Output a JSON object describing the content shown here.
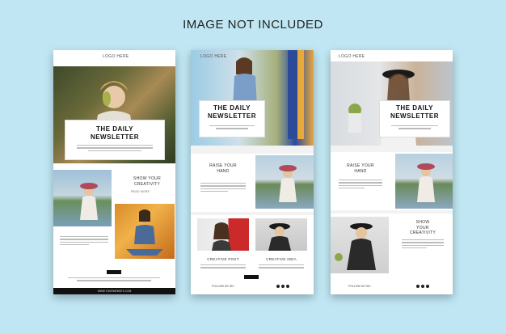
{
  "banner": "IMAGE NOT INCLUDED",
  "card1": {
    "logo": "LOGO HERE",
    "title_line1": "THE DAILY",
    "title_line2": "NEWSLETTER",
    "side_heading_1": "SHOW YOUR",
    "side_heading_2": "CREATIVITY",
    "read_more": "READ MORE",
    "footer": "WWW.YOURWEBSITE.COM"
  },
  "card2": {
    "logo": "LOGO HERE",
    "title_line1": "THE DAILY",
    "title_line2": "NEWSLETTER",
    "raise_1": "RAISE YOUR",
    "raise_2": "HAND",
    "creative_post": "CREATIVE POST",
    "creative_idea": "CREATIVE IDEA",
    "follow": "FOLLOW US ON :"
  },
  "card3": {
    "logo": "LOGO HERE",
    "title_line1": "THE DAILY",
    "title_line2": "NEWSLETTER",
    "raise_1": "RAISE YOUR",
    "raise_2": "HAND",
    "show_1": "SHOW",
    "show_2": "YOUR",
    "show_3": "CREATIVITY",
    "follow": "FOLLOW US ON :"
  },
  "colors": {
    "background": "#bfe6f2",
    "card": "#ffffff",
    "dark": "#111111"
  },
  "icons": [
    "facebook-icon",
    "instagram-icon",
    "twitter-icon"
  ]
}
